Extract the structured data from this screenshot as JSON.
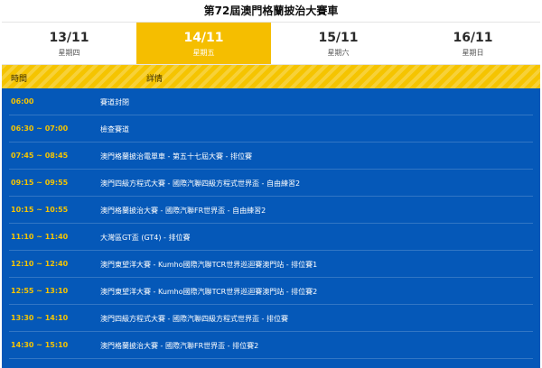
{
  "page_title": "第72屆澳門格蘭披治大賽車",
  "tabs": [
    {
      "date": "13/11",
      "weekday": "星期四",
      "active": false
    },
    {
      "date": "14/11",
      "weekday": "星期五",
      "active": true
    },
    {
      "date": "15/11",
      "weekday": "星期六",
      "active": false
    },
    {
      "date": "16/11",
      "weekday": "星期日",
      "active": false
    }
  ],
  "header": {
    "time_label": "時間",
    "detail_label": "詳情"
  },
  "colors": {
    "accent_yellow": "#f5c400",
    "schedule_blue": "#0558b8"
  },
  "schedule": [
    {
      "time": "06:00",
      "event": "賽道封閉"
    },
    {
      "time": "06:30 ~ 07:00",
      "event": "檢查賽道"
    },
    {
      "time": "07:45 ~ 08:45",
      "event": "澳門格蘭披治電單車 - 第五十七屆大賽 - 排位賽"
    },
    {
      "time": "09:15 ~ 09:55",
      "event": "澳門四級方程式大賽 - 國際汽聯四級方程式世界盃 - 自由練習2"
    },
    {
      "time": "10:15 ~ 10:55",
      "event": "澳門格蘭披治大賽 - 國際汽聯FR世界盃 - 自由練習2"
    },
    {
      "time": "11:10 ~ 11:40",
      "event": "大灣區GT盃 (GT4) - 排位賽"
    },
    {
      "time": "12:10 ~ 12:40",
      "event": "澳門東望洋大賽 - Kumho國際汽聯TCR世界巡迴賽澳門站 - 排位賽1"
    },
    {
      "time": "12:55 ~ 13:10",
      "event": "澳門東望洋大賽 - Kumho國際汽聯TCR世界巡迴賽澳門站 - 排位賽2"
    },
    {
      "time": "13:30 ~ 14:10",
      "event": "澳門四級方程式大賽 - 國際汽聯四級方程式世界盃 - 排位賽"
    },
    {
      "time": "14:30 ~ 15:10",
      "event": "澳門格蘭披治大賽 - 國際汽聯FR世界盃 - 排位賽2"
    }
  ]
}
